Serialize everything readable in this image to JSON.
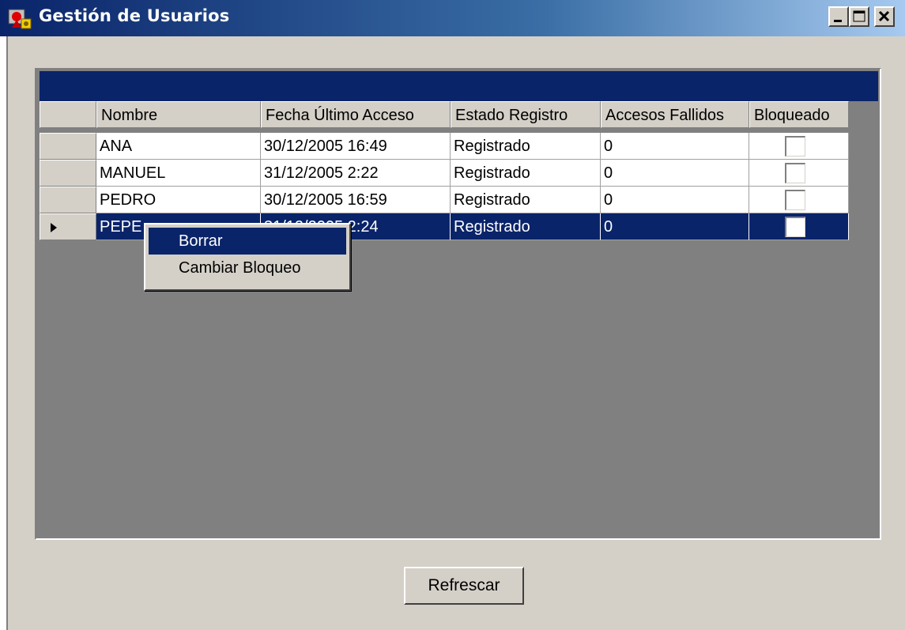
{
  "window": {
    "title": "Gestión de Usuarios",
    "icon": "users-app-icon",
    "controls": [
      "minimize-icon",
      "maximize-icon",
      "close-icon"
    ]
  },
  "grid": {
    "columns": [
      "Nombre",
      "Fecha Último Acceso",
      "Estado Registro",
      "Accesos Fallidos",
      "Bloqueado"
    ],
    "rows": [
      {
        "nombre": "ANA",
        "fecha": "30/12/2005 16:49",
        "estado": "Registrado",
        "fallidos": "0",
        "bloqueado": false,
        "selected": false
      },
      {
        "nombre": "MANUEL",
        "fecha": "31/12/2005 2:22",
        "estado": "Registrado",
        "fallidos": "0",
        "bloqueado": false,
        "selected": false
      },
      {
        "nombre": "PEDRO",
        "fecha": "30/12/2005 16:59",
        "estado": "Registrado",
        "fallidos": "0",
        "bloqueado": false,
        "selected": false
      },
      {
        "nombre": "PEPE",
        "fecha": "31/12/2005 2:24",
        "estado": "Registrado",
        "fallidos": "0",
        "bloqueado": false,
        "selected": true
      }
    ]
  },
  "context_menu": {
    "items": [
      "Borrar",
      "Cambiar Bloqueo"
    ],
    "highlighted": "Borrar"
  },
  "buttons": {
    "refresh_label": "Refrescar"
  },
  "colors": {
    "title_gradient_start": "#0a246a",
    "selection": "#0a246a",
    "face": "#d4d0c8",
    "grid_background": "#808080"
  }
}
